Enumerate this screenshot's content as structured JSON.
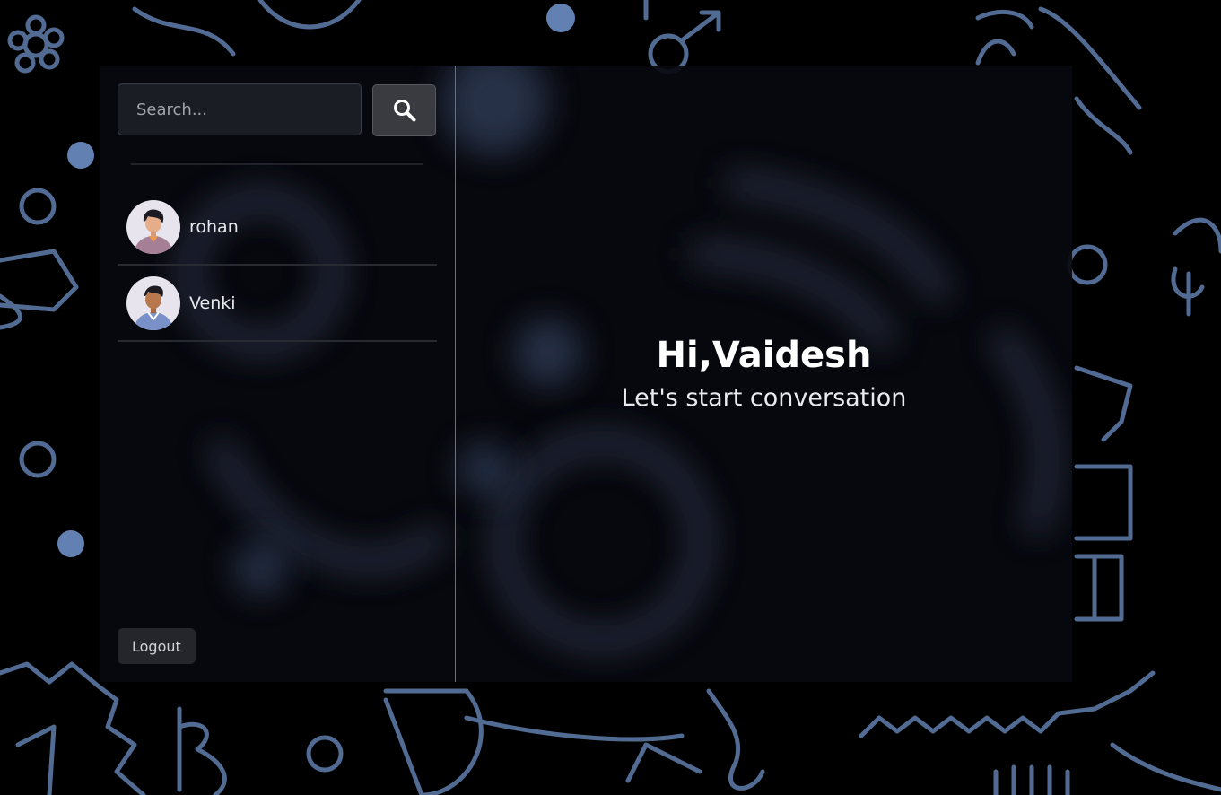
{
  "search": {
    "placeholder": "Search...",
    "button_icon": "search-icon"
  },
  "contacts": [
    {
      "name": "rohan",
      "avatar_icon": "avatar-illustration"
    },
    {
      "name": "Venki",
      "avatar_icon": "avatar-illustration"
    }
  ],
  "welcome": {
    "greeting": "Hi,Vaidesh",
    "subtitle": "Let's start conversation"
  },
  "logout_label": "Logout",
  "colors": {
    "background": "#000000",
    "doodle": "#5a7fb8",
    "panel": "#08090e",
    "search_field": "#1a1d24",
    "search_button": "#393b40",
    "divider": "#6b6e80"
  }
}
